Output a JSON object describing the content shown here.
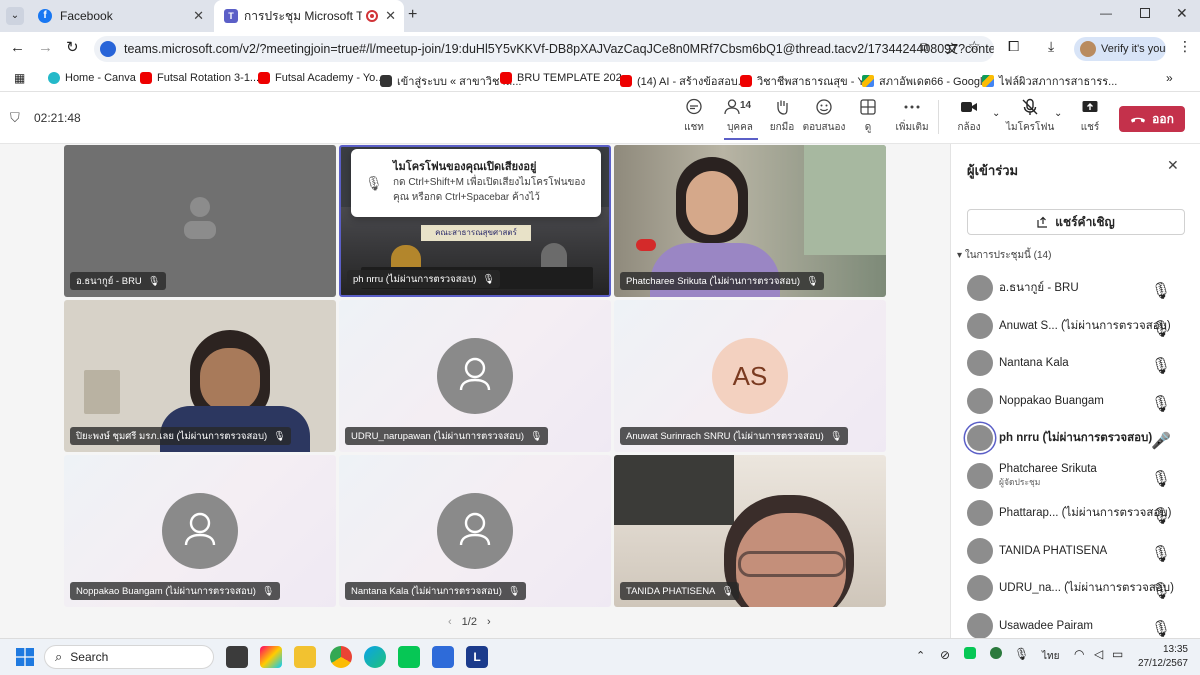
{
  "browser": {
    "tabs": [
      {
        "title": "Facebook",
        "active": false
      },
      {
        "title": "การประชุม Microsoft Teams |",
        "active": true
      }
    ],
    "url": "teams.microsoft.com/v2/?meetingjoin=true#/l/meetup-join/19:duHl5Y5vKKVf-DB8pXAJVazCaqJCe8n0MRf7Cbsm6bQ1@thread.tacv2/1734424408097?context=...",
    "profile_label": "Verify it's you",
    "bookmarks": [
      "Home - Canva",
      "Futsal Rotation 3-1...",
      "Futsal Academy - Yo...",
      "เข้าสู่ระบบ « สาขาวิชาส...",
      "BRU TEMPLATE 202...",
      "(14) AI - สร้างข้อสอบ...",
      "วิชาชีพสาธารณสุข - Y...",
      "สภาอัพเดต66 - Googl...",
      "ไฟล์ผิวสภาการสาธารร..."
    ]
  },
  "meeting": {
    "timer": "02:21:48",
    "participant_count": "14",
    "toolbar": {
      "chat": "แชท",
      "people": "บุคคล",
      "raise": "ยกมือ",
      "react": "ตอบสนอง",
      "view": "ดู",
      "more": "เพิ่มเติม",
      "camera": "กล้อง",
      "mic": "ไมโครโฟน",
      "share": "แชร์",
      "leave": "ออก"
    },
    "mic_toast": {
      "title": "ไมโครโฟนของคุณเปิดเสียงอยู่",
      "body": "กด Ctrl+Shift+M เพื่อเปิดเสียงไมโครโฟนของคุณ หรือกด Ctrl+Spacebar ค้างไว้"
    },
    "room_sign": "คณะสาธารณสุขศาสตร์",
    "tiles": [
      {
        "name": "อ.ธนากูย์ - BRU"
      },
      {
        "name": "ph nrru (ไม่ผ่านการตรวจสอบ)"
      },
      {
        "name": "Phatcharee Srikuta (ไม่ผ่านการตรวจสอบ)"
      },
      {
        "name": "ปิยะพงษ์ ชุมศรี มรภ.เลย (ไม่ผ่านการตรวจสอบ)"
      },
      {
        "name": "UDRU_narupawan (ไม่ผ่านการตรวจสอบ)"
      },
      {
        "name": "Anuwat Surinrach SNRU (ไม่ผ่านการตรวจสอบ)",
        "initials": "AS"
      },
      {
        "name": "Noppakao Buangam (ไม่ผ่านการตรวจสอบ)"
      },
      {
        "name": "Nantana Kala (ไม่ผ่านการตรวจสอบ)"
      },
      {
        "name": "TANIDA PHATISENA"
      }
    ],
    "pagination": "1/2"
  },
  "panel": {
    "title": "ผู้เข้าร่วม",
    "share_invite": "แชร์คำเชิญ",
    "section": "ในการประชุมนี้ (14)",
    "participants": [
      {
        "name": "อ.ธนากูย์ - BRU"
      },
      {
        "name": "Anuwat S... (ไม่ผ่านการตรวจสอบ)"
      },
      {
        "name": "Nantana Kala"
      },
      {
        "name": "Noppakao Buangam"
      },
      {
        "name": "ph nrru (ไม่ผ่านการตรวจสอบ)",
        "sub": ""
      },
      {
        "name": "Phatcharee Srikuta",
        "sub": "ผู้จัดประชุม"
      },
      {
        "name": "Phattarap... (ไม่ผ่านการตรวจสอบ)"
      },
      {
        "name": "TANIDA PHATISENA"
      },
      {
        "name": "UDRU_na... (ไม่ผ่านการตรวจสอบ)"
      },
      {
        "name": "Usawadee Pairam"
      }
    ]
  },
  "taskbar": {
    "search_placeholder": "Search",
    "language": "ไทย",
    "time": "13:35",
    "date": "27/12/2567"
  }
}
